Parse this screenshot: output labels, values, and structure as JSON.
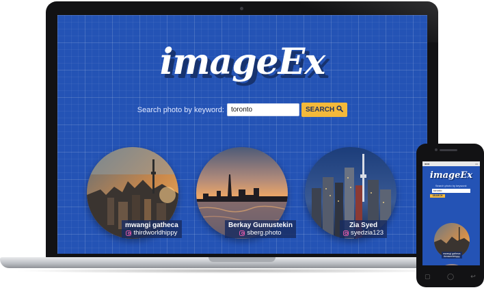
{
  "app": {
    "logo_text": "imageEx"
  },
  "search": {
    "label": "Search photo by keyword:",
    "value": "toronto",
    "button_label": "SEARCH",
    "button_icon": "magnifier-icon"
  },
  "photos": [
    {
      "name": "mwangi gatheca",
      "handle": "thirdworldhippy",
      "handle_icon": "instagram-icon"
    },
    {
      "name": "Berkay Gumustekin",
      "handle": "sberg.photo",
      "handle_icon": "instagram-icon"
    },
    {
      "name": "Zia Syed",
      "handle": "syedzia123",
      "handle_icon": "instagram-icon"
    }
  ],
  "mobile": {
    "logo_text": "imageEx",
    "search_label": "Search photo by keyword:",
    "search_value": "toronto",
    "button_label": "SEARCH",
    "first_credit_name": "mwangi gatheca",
    "first_credit_handle": "thirdworldhippy"
  },
  "colors": {
    "background_blue": "#2453b5",
    "search_button": "#f4b93a",
    "logo_shadow": "#17336f",
    "credit_background": "#182c60"
  }
}
